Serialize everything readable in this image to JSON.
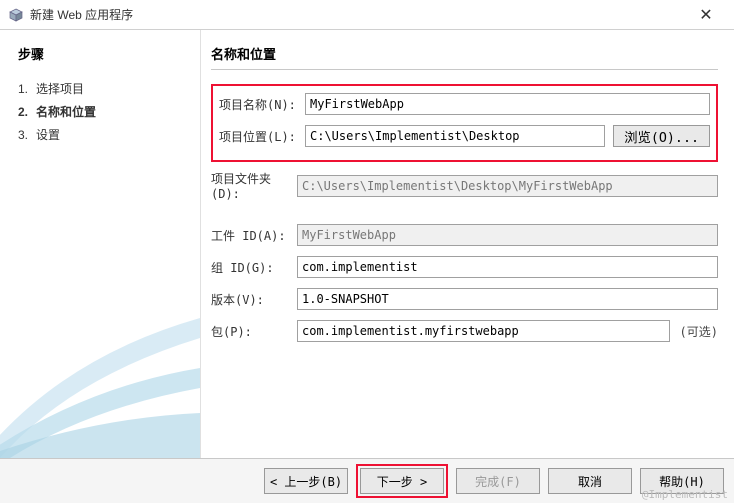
{
  "window": {
    "title": "新建 Web 应用程序",
    "close": "✕"
  },
  "sidebar": {
    "heading": "步骤",
    "steps": [
      {
        "num": "1.",
        "label": "选择项目"
      },
      {
        "num": "2.",
        "label": "名称和位置"
      },
      {
        "num": "3.",
        "label": "设置"
      }
    ]
  },
  "content": {
    "heading": "名称和位置",
    "labels": {
      "project_name": "项目名称(N):",
      "project_location": "项目位置(L):",
      "project_folder": "项目文件夹(D):",
      "artifact_id": "工件 ID(A):",
      "group_id": "组 ID(G):",
      "version": "版本(V):",
      "package": "包(P):",
      "browse": "浏览(O)...",
      "optional": "(可选)"
    },
    "values": {
      "project_name": "MyFirstWebApp",
      "project_location": "C:\\Users\\Implementist\\Desktop",
      "project_folder": "C:\\Users\\Implementist\\Desktop\\MyFirstWebApp",
      "artifact_id": "MyFirstWebApp",
      "group_id": "com.implementist",
      "version": "1.0-SNAPSHOT",
      "package": "com.implementist.myfirstwebapp"
    }
  },
  "buttons": {
    "back": "< 上一步(B)",
    "next": "下一步 >",
    "finish": "完成(F)",
    "cancel": "取消",
    "help": "帮助(H)"
  },
  "watermark": "@Implementist"
}
